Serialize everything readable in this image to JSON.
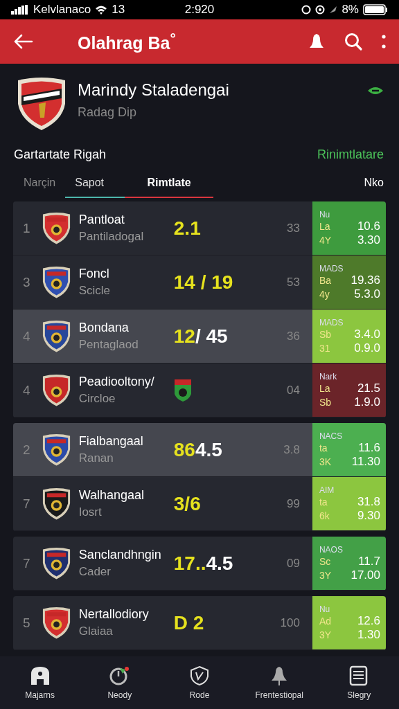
{
  "status_bar": {
    "carrier": "Kelvlanaco",
    "network": "13",
    "time": "2:920",
    "battery": "8%"
  },
  "app_bar": {
    "title": "Olahrag Ba$^{°}$"
  },
  "club": {
    "name": "Marindy Staladengai",
    "subtitle": "Radag Dip"
  },
  "section": {
    "title": "Gartartate Rigah",
    "link": "Rinimtlatare"
  },
  "tabs": [
    {
      "label": "Narçin",
      "selected": false
    },
    {
      "label": "Sapot",
      "selected": false,
      "color": "#4db6ac"
    },
    {
      "label": "Rimtlate",
      "selected": true,
      "color": "#d9363e"
    },
    {
      "label": "Nko",
      "selected": false
    }
  ],
  "groups": [
    {
      "rows": [
        {
          "rank": "1",
          "team": "Pantloat",
          "sub": "Pantiladogal",
          "crest": {
            "color": "#d32f2f"
          },
          "kind": "score",
          "score_lead": "2.1",
          "score_rest": "",
          "points": "33",
          "highlighted": false,
          "odds": {
            "color": "#3e9b3e",
            "head": "Nu",
            "lines": [
              [
                "La",
                "10.6"
              ],
              [
                "4Y",
                "3.30"
              ]
            ]
          }
        },
        {
          "rank": "3",
          "team": "Foncl",
          "sub": "Scicle",
          "crest": {
            "color": "#2f4fb0"
          },
          "kind": "score",
          "score_lead": "14 / 19",
          "score_rest": "",
          "points": "53",
          "highlighted": false,
          "odds": {
            "color": "#4e7a2a",
            "head": "MADS",
            "lines": [
              [
                "Ba",
                "19.36"
              ],
              [
                "4y",
                "5.3.0"
              ]
            ]
          }
        },
        {
          "rank": "4",
          "team": "Bondana",
          "sub": "Pentaglaod",
          "crest": {
            "color": "#27479a"
          },
          "kind": "score",
          "score_lead": "12",
          "score_rest": "/ 45",
          "points": "36",
          "highlighted": true,
          "odds": {
            "color": "#8cc63f",
            "head": "MADS",
            "lines": [
              [
                "Sb",
                "3.4.0"
              ],
              [
                "31",
                "0.9.0"
              ]
            ]
          }
        },
        {
          "rank": "4",
          "team": "Peadiooltony/",
          "sub": "Circloe",
          "crest": {
            "color": "#c62828"
          },
          "kind": "badge",
          "score_lead": "",
          "score_rest": "",
          "points": "04",
          "highlighted": false,
          "odds": {
            "color": "#6b2429",
            "head": "Nark",
            "lines": [
              [
                "La",
                "21.5"
              ],
              [
                "Sb",
                "1.9.0"
              ]
            ]
          }
        }
      ]
    },
    {
      "rows": [
        {
          "rank": "2",
          "team": "Fialbangaal",
          "sub": "Ranan",
          "crest": {
            "color": "#2b4aa8"
          },
          "kind": "score",
          "score_lead": "86",
          "score_rest": "4.5",
          "points": "3.8",
          "highlighted": true,
          "odds": {
            "color": "#4caf50",
            "head": "NACS",
            "lines": [
              [
                "ta",
                "11.6"
              ],
              [
                "3K",
                "11.30"
              ]
            ]
          }
        },
        {
          "rank": "7",
          "team": "Walhangaal",
          "sub": "Iosrt",
          "crest": {
            "color": "#1a1a1a"
          },
          "kind": "score",
          "score_lead": "3/6",
          "score_rest": "",
          "points": "99",
          "highlighted": false,
          "odds": {
            "color": "#8cc63f",
            "head": "AIM",
            "lines": [
              [
                "ta",
                "31.8"
              ],
              [
                "6k",
                "9.30"
              ]
            ]
          }
        }
      ]
    },
    {
      "rows": [
        {
          "rank": "7",
          "team": "Sanclandhngin",
          "sub": "Cader",
          "crest": {
            "color": "#1f2f6e"
          },
          "kind": "score",
          "score_lead": "17..",
          "score_rest": "4.5",
          "points": "09",
          "highlighted": false,
          "odds": {
            "color": "#43a047",
            "head": "NAOS",
            "lines": [
              [
                "Sc",
                "11.7"
              ],
              [
                "3Y",
                "17.00"
              ]
            ]
          }
        }
      ]
    },
    {
      "rows": [
        {
          "rank": "5",
          "team": "Nertallodiory",
          "sub": "Glaiaa",
          "crest": {
            "color": "#d32f2f"
          },
          "kind": "score",
          "score_lead": "D 2",
          "score_rest": "",
          "points": "100",
          "highlighted": false,
          "odds": {
            "color": "#8cc63f",
            "head": "Nu",
            "lines": [
              [
                "Ad",
                "12.6"
              ],
              [
                "3Y",
                "1.30"
              ]
            ]
          }
        }
      ]
    }
  ],
  "bottom_nav": [
    {
      "label": "Majarns",
      "kind": "home"
    },
    {
      "label": "Neody",
      "kind": "timer"
    },
    {
      "label": "Rode",
      "kind": "shield"
    },
    {
      "label": "Frentestiopal",
      "kind": "bell"
    },
    {
      "label": "Slegry",
      "kind": "list"
    }
  ]
}
